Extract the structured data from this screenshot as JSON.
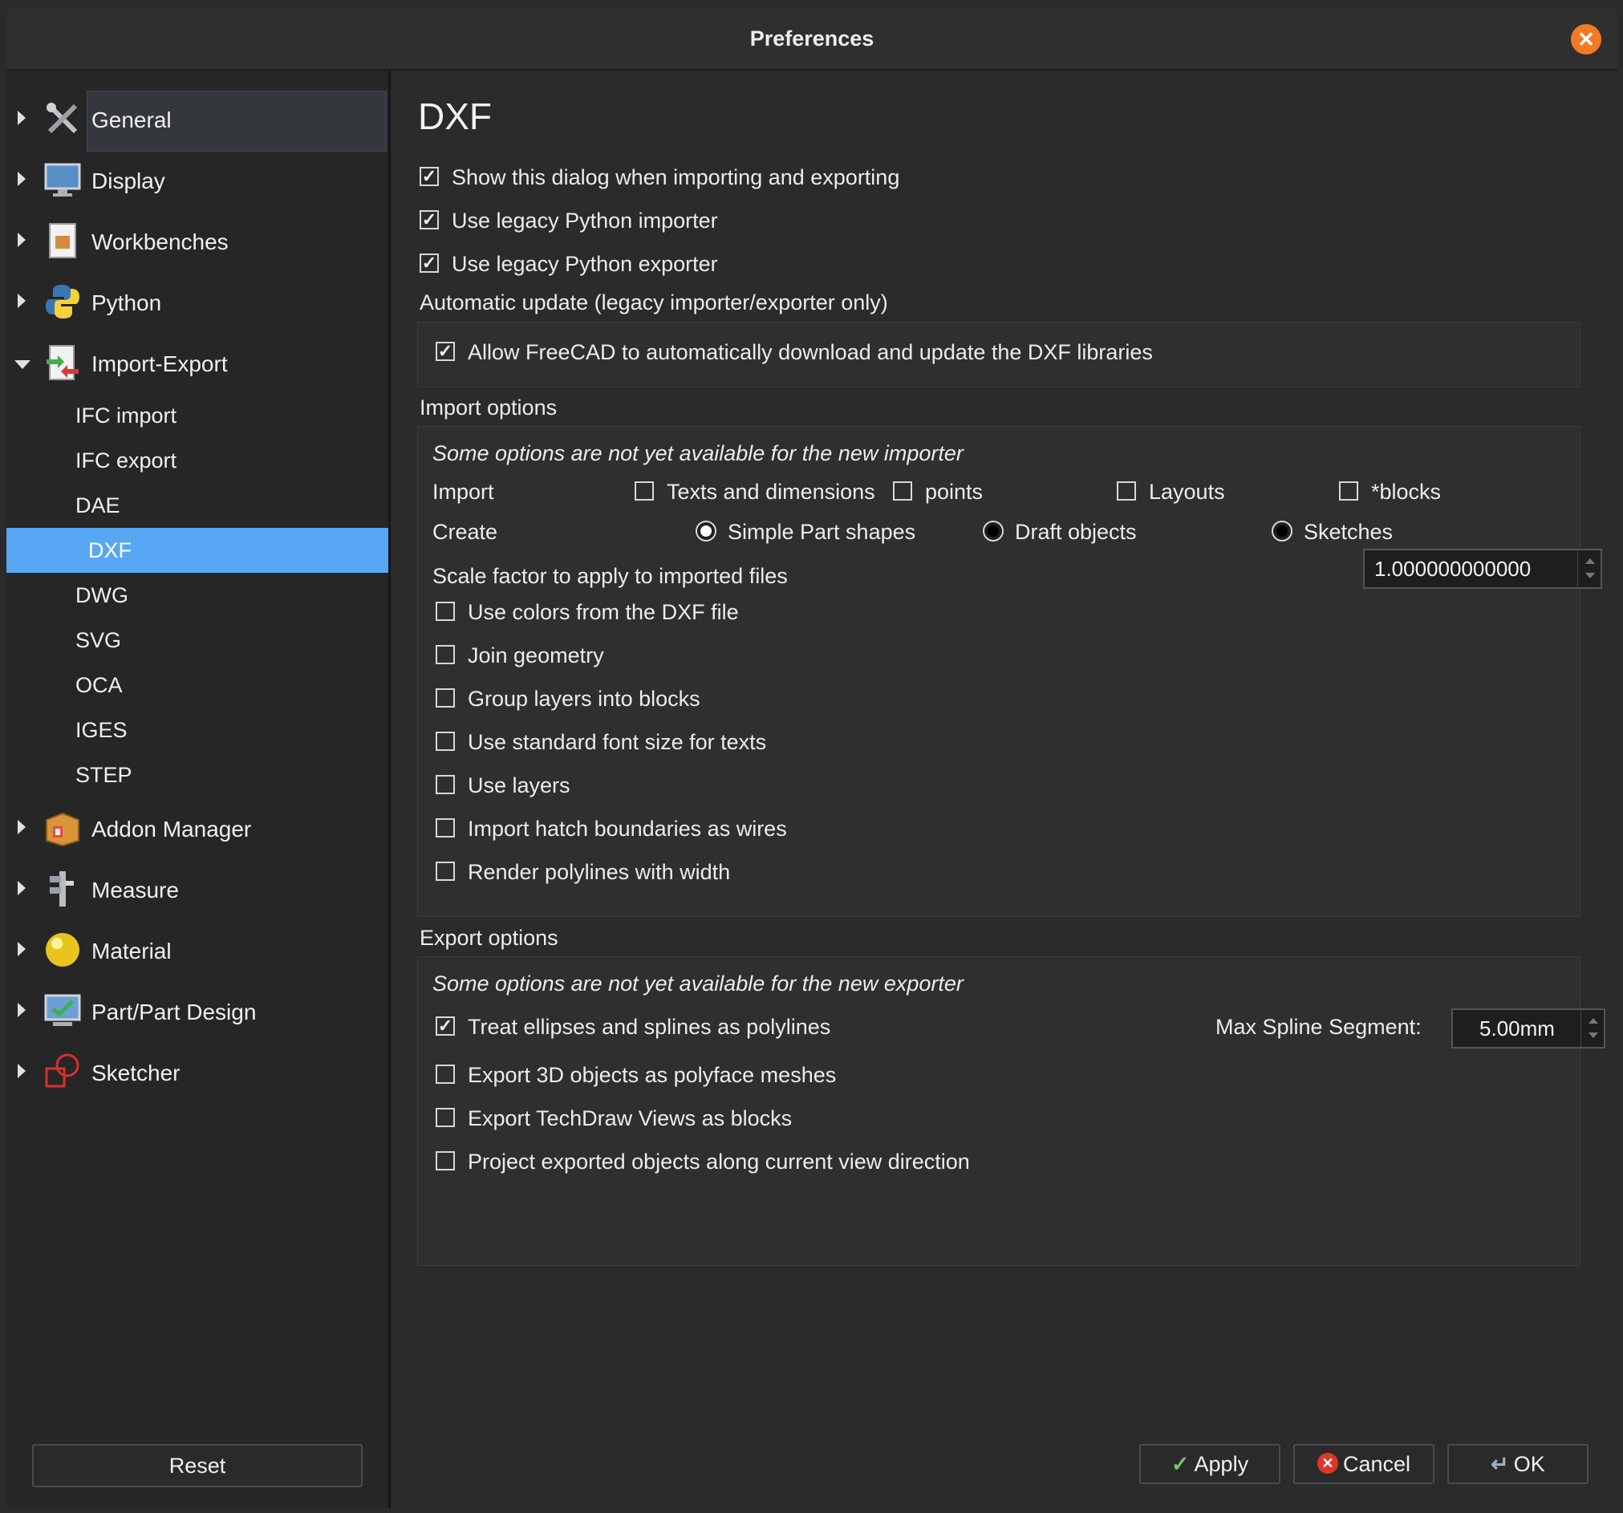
{
  "window": {
    "title": "Preferences"
  },
  "sidebar": {
    "categories_top": [
      {
        "label": "General",
        "icon": "tools-icon"
      },
      {
        "label": "Display",
        "icon": "monitor-icon"
      },
      {
        "label": "Workbenches",
        "icon": "workbench-icon"
      },
      {
        "label": "Python",
        "icon": "python-icon"
      },
      {
        "label": "Import-Export",
        "icon": "import-export-icon"
      }
    ],
    "subitems": [
      "IFC import",
      "IFC export",
      "DAE",
      "DXF",
      "DWG",
      "SVG",
      "OCA",
      "IGES",
      "STEP"
    ],
    "active_subitem": "DXF",
    "categories_bottom": [
      {
        "label": "Addon Manager",
        "icon": "addon-box-icon"
      },
      {
        "label": "Measure",
        "icon": "caliper-icon"
      },
      {
        "label": "Material",
        "icon": "material-sphere-icon"
      },
      {
        "label": "Part/Part Design",
        "icon": "part-design-icon"
      },
      {
        "label": "Sketcher",
        "icon": "sketcher-icon"
      }
    ],
    "reset_label": "Reset"
  },
  "main": {
    "title": "DXF",
    "top_options": [
      {
        "label": "Show this dialog when importing and exporting",
        "checked": true
      },
      {
        "label": "Use legacy Python importer",
        "checked": true
      },
      {
        "label": "Use legacy Python exporter",
        "checked": true
      }
    ],
    "auto_update": {
      "heading": "Automatic update (legacy importer/exporter only)",
      "option": {
        "label": "Allow FreeCAD to automatically download and update the DXF libraries",
        "checked": true
      }
    },
    "import": {
      "heading": "Import options",
      "note": "Some options are not yet available for the new importer",
      "import_label": "Import",
      "import_checks": [
        {
          "label": "Texts and dimensions",
          "checked": false
        },
        {
          "label": "points",
          "checked": false
        },
        {
          "label": "Layouts",
          "checked": false
        },
        {
          "label": "*blocks",
          "checked": false
        }
      ],
      "create_label": "Create",
      "create_radios": [
        {
          "label": "Simple Part shapes",
          "selected": true
        },
        {
          "label": "Draft objects",
          "selected": false
        },
        {
          "label": "Sketches",
          "selected": false
        }
      ],
      "scale_label": "Scale factor to apply to imported files",
      "scale_value": "1.000000000000",
      "options": [
        {
          "label": "Use colors from the DXF file",
          "checked": false
        },
        {
          "label": "Join geometry",
          "checked": false
        },
        {
          "label": "Group layers into blocks",
          "checked": false
        },
        {
          "label": "Use standard font size for texts",
          "checked": false
        },
        {
          "label": "Use layers",
          "checked": false
        },
        {
          "label": "Import hatch boundaries as wires",
          "checked": false
        },
        {
          "label": "Render polylines with width",
          "checked": false
        }
      ]
    },
    "export": {
      "heading": "Export options",
      "note": "Some options are not yet available for the new exporter",
      "options": [
        {
          "label": "Treat ellipses and splines as polylines",
          "checked": true
        },
        {
          "label": "Export 3D objects as polyface meshes",
          "checked": false
        },
        {
          "label": "Export TechDraw Views as blocks",
          "checked": false
        },
        {
          "label": "Project exported objects along current view direction",
          "checked": false
        }
      ],
      "spline_label": "Max Spline Segment:",
      "spline_value": "5.00mm"
    }
  },
  "buttons": {
    "apply": "Apply",
    "cancel": "Cancel",
    "ok": "OK"
  },
  "colors": {
    "selection": "#57a7f5",
    "close_button": "#f37a25",
    "background": "#2b2b2b"
  }
}
